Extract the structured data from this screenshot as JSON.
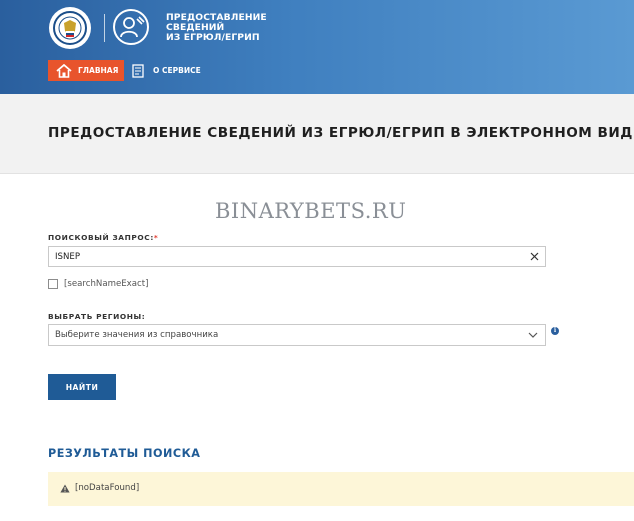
{
  "header": {
    "service_title_lines": [
      "ПРЕДОСТАВЛЕНИЕ",
      "СВЕДЕНИЙ",
      "ИЗ ЕГРЮЛ/ЕГРИП"
    ]
  },
  "nav": {
    "home_label": "ГЛАВНАЯ",
    "about_label": "О СЕРВИСЕ"
  },
  "page": {
    "title": "ПРЕДОСТАВЛЕНИЕ СВЕДЕНИЙ ИЗ ЕГРЮЛ/ЕГРИП В ЭЛЕКТРОННОМ ВИДЕ",
    "watermark": "BINARYBETS.RU"
  },
  "form": {
    "query_label": "ПОИСКОВЫЙ ЗАПРОС:",
    "required_mark": "*",
    "query_value": "ISNEP",
    "exact_checkbox_label": "[searchNameExact]",
    "exact_checked": false,
    "region_label": "ВЫБРАТЬ РЕГИОНЫ:",
    "region_placeholder": "Выберите значения из справочника",
    "info_glyph": "i",
    "submit_label": "НАЙТИ"
  },
  "results": {
    "title": "РЕЗУЛЬТАТЫ ПОИСКА",
    "message": "[noDataFound]"
  },
  "colors": {
    "header_blue": "#3f7fbf",
    "home_orange": "#e8542c",
    "button_blue": "#1f5b96",
    "alert_bg": "#fdf6d8",
    "required_red": "#e03a2f"
  }
}
